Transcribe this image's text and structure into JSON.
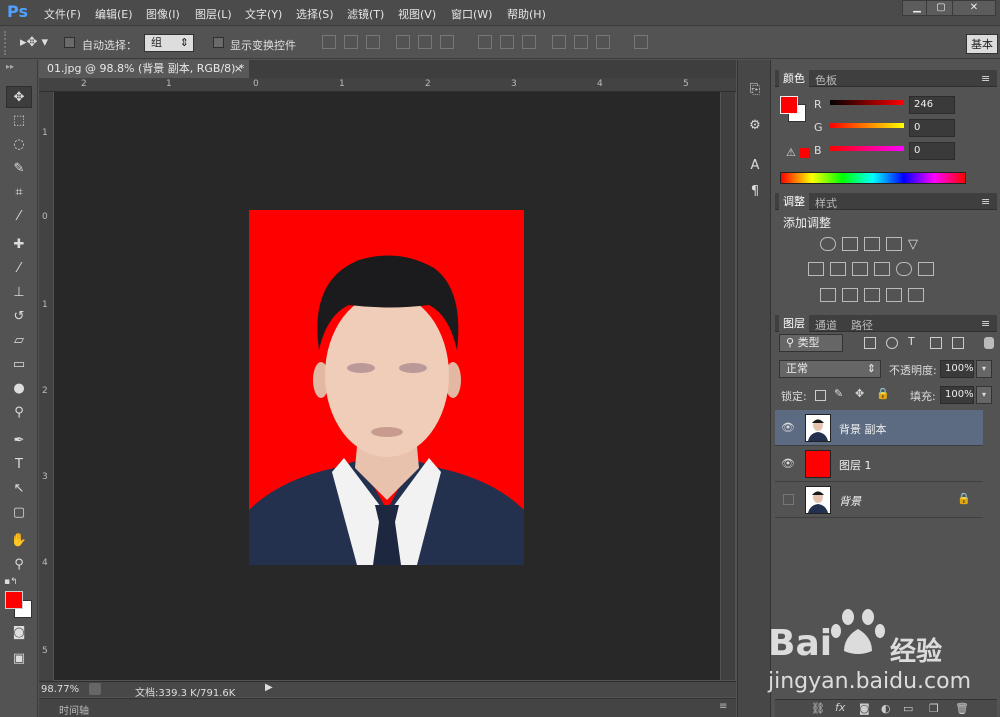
{
  "menubar": {
    "logo": "Ps",
    "items": [
      "文件(F)",
      "编辑(E)",
      "图像(I)",
      "图层(L)",
      "文字(Y)",
      "选择(S)",
      "滤镜(T)",
      "视图(V)",
      "窗口(W)",
      "帮助(H)"
    ],
    "window_buttons": [
      "▁",
      "▢",
      "✕"
    ]
  },
  "options": {
    "auto_select_label": "自动选择：",
    "auto_select_value": "组",
    "show_transform_label": "显示变换控件",
    "workspace_button": "基本"
  },
  "document": {
    "tab_title": "01.jpg @ 98.8% (背景 副本, RGB/8) *",
    "tab_close": "×",
    "ruler_h_marks": [
      "2",
      "1",
      "0",
      "1",
      "2",
      "3",
      "4",
      "5"
    ],
    "ruler_v_marks": [
      "1",
      "0",
      "1",
      "2",
      "3",
      "4",
      "5"
    ],
    "zoom": "98.77%",
    "doc_info": "文档:339.3 K/791.6K",
    "timeline_label": "时间轴"
  },
  "panels": {
    "color": {
      "tabs": [
        "颜色",
        "色板"
      ],
      "fg_color": "#ff0000",
      "bg_color": "#ffffff",
      "channels": [
        {
          "label": "R",
          "value": "246"
        },
        {
          "label": "G",
          "value": "0"
        },
        {
          "label": "B",
          "value": "0"
        }
      ]
    },
    "adjustments": {
      "tabs": [
        "调整",
        "样式"
      ],
      "title": "添加调整"
    },
    "layers": {
      "tabs": [
        "图层",
        "通道",
        "路径"
      ],
      "filter_label": "类型",
      "blend_mode": "正常",
      "opacity_label": "不透明度:",
      "opacity_value": "100%",
      "lock_label": "锁定:",
      "fill_label": "填充:",
      "fill_value": "100%",
      "items": [
        {
          "name": "背景 副本",
          "selected": true,
          "visible": true
        },
        {
          "name": "图层 1",
          "selected": false,
          "visible": true
        },
        {
          "name": "背景",
          "selected": false,
          "visible": false,
          "locked": true
        }
      ]
    }
  },
  "watermark": {
    "brand": "Bai",
    "brand_suffix": "经验",
    "url": "jingyan.baidu.com"
  },
  "colors": {
    "photo_bg": "#ff0000",
    "selected_layer": "#5c6b82",
    "ps_blue": "#4fa0ff"
  }
}
